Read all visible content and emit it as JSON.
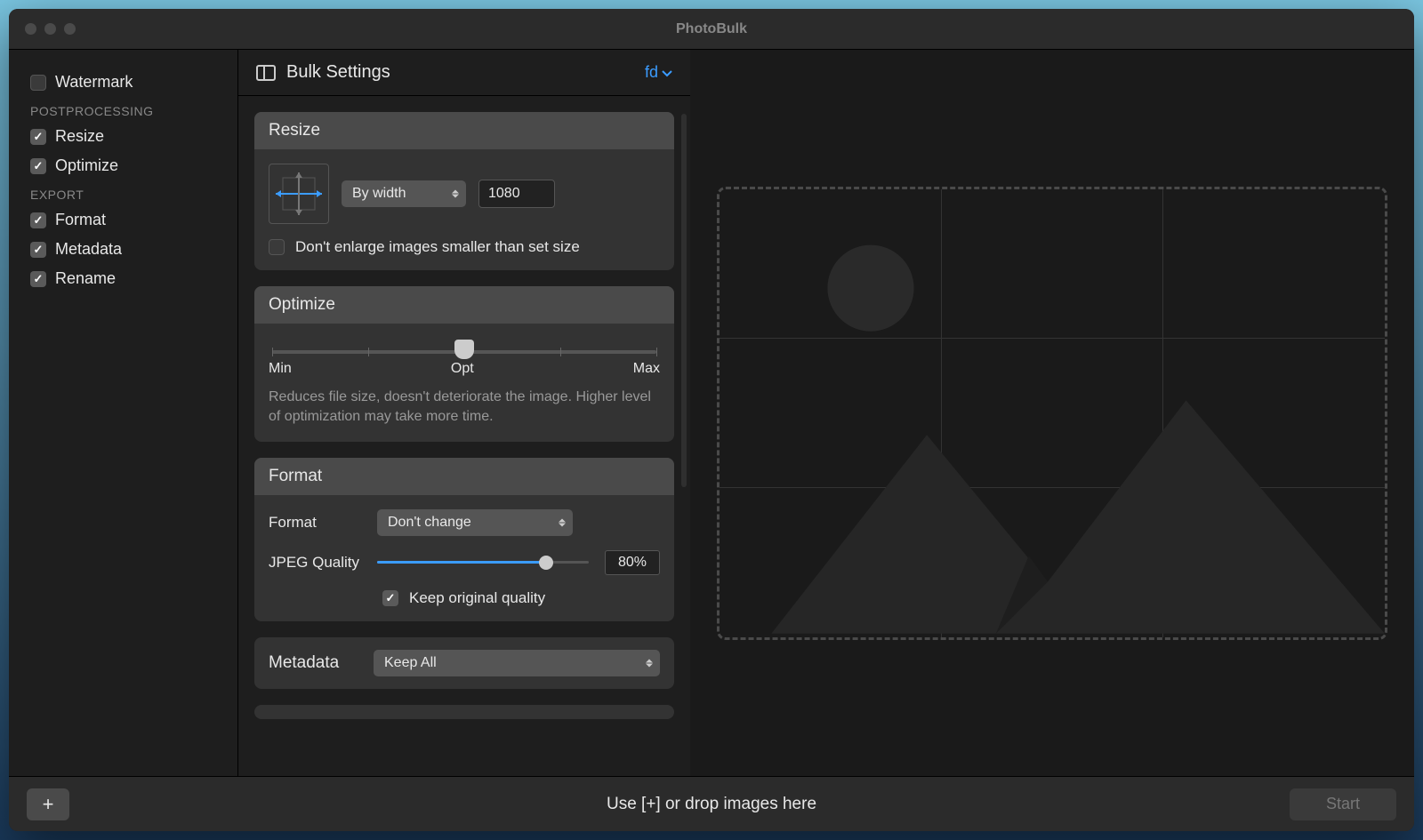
{
  "window": {
    "title": "PhotoBulk"
  },
  "sidebar": {
    "watermark": {
      "label": "Watermark",
      "checked": false
    },
    "section_postprocessing": "POSTPROCESSING",
    "resize": {
      "label": "Resize",
      "checked": true
    },
    "optimize": {
      "label": "Optimize",
      "checked": true
    },
    "section_export": "EXPORT",
    "format": {
      "label": "Format",
      "checked": true
    },
    "metadata": {
      "label": "Metadata",
      "checked": true
    },
    "rename": {
      "label": "Rename",
      "checked": true
    }
  },
  "settings": {
    "title": "Bulk Settings",
    "preset": "fd",
    "resize": {
      "header": "Resize",
      "mode": "By width",
      "value": "1080",
      "dont_enlarge_label": "Don't enlarge images smaller than set size",
      "dont_enlarge_checked": false
    },
    "optimize": {
      "header": "Optimize",
      "labels": {
        "min": "Min",
        "opt": "Opt",
        "max": "Max"
      },
      "position_percent": 50,
      "help": "Reduces file size, doesn't deteriorate the image. Higher level of optimization may take more time."
    },
    "format": {
      "header": "Format",
      "format_label": "Format",
      "format_value": "Don't change",
      "quality_label": "JPEG Quality",
      "quality_percent": 80,
      "quality_display": "80%",
      "keep_original_label": "Keep original quality",
      "keep_original_checked": true
    },
    "metadata": {
      "header": "Metadata",
      "value": "Keep All"
    }
  },
  "bottom": {
    "hint": "Use [+] or drop images here",
    "start": "Start",
    "add": "+"
  }
}
